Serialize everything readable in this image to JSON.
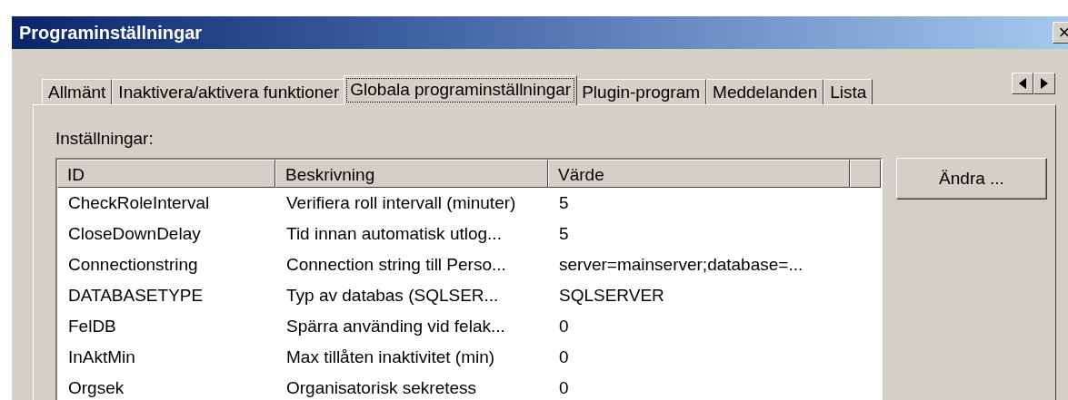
{
  "window": {
    "title": "Programinställningar",
    "close": "×"
  },
  "tabs": [
    {
      "label": "Allmänt",
      "selected": false
    },
    {
      "label": "Inaktivera/aktivera funktioner",
      "selected": false
    },
    {
      "label": "Globala programinställningar",
      "selected": true
    },
    {
      "label": "Plugin-program",
      "selected": false
    },
    {
      "label": "Meddelanden",
      "selected": false
    },
    {
      "label": "Lista",
      "selected": false
    }
  ],
  "settings_label": "Inställningar:",
  "table": {
    "columns": [
      "ID",
      "Beskrivning",
      "Värde"
    ],
    "rows": [
      [
        "CheckRoleInterval",
        "Verifiera roll intervall (minuter)",
        "5"
      ],
      [
        "CloseDownDelay",
        "Tid innan automatisk utlog...",
        "5"
      ],
      [
        "Connectionstring",
        "Connection string till Perso...",
        "server=mainserver;database=..."
      ],
      [
        "DATABASETYPE",
        "Typ av databas (SQLSER...",
        "SQLSERVER"
      ],
      [
        "FelDB",
        "Spärra använding vid felak...",
        "0"
      ],
      [
        "InAktMin",
        "Max tillåten inaktivitet (min)",
        "0"
      ],
      [
        "Orgsek",
        "Organisatorisk sekretess",
        "0"
      ]
    ]
  },
  "edit_button": "Ändra ..."
}
